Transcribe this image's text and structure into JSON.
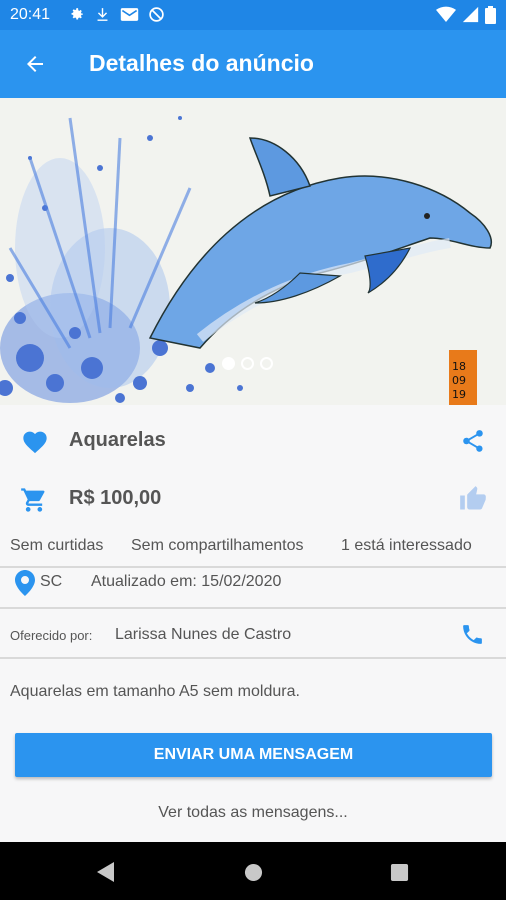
{
  "status_bar": {
    "time": "20:41",
    "left_icons": [
      "gear-icon",
      "download-icon",
      "gmail-icon",
      "do-not-disturb-icon"
    ],
    "right_icons": [
      "wifi-icon",
      "signal-icon",
      "battery-icon"
    ]
  },
  "app_bar": {
    "title": "Detalhes do anúncio",
    "back_icon": "arrow-left-icon"
  },
  "gallery": {
    "image": "watercolor-dolphin-painting",
    "dot_count": 3,
    "active_index": 0,
    "painting_label": "18 09 19"
  },
  "item": {
    "title": "Aquarelas",
    "price": "R$ 100,00",
    "stats": {
      "likes": "Sem curtidas",
      "shares": "Sem compartilhamentos",
      "interested": "1 está interessado"
    },
    "location": "SC",
    "updated": "Atualizado em: 15/02/2020",
    "offered_by_label": "Oferecido por:",
    "seller": "Larissa Nunes de Castro",
    "description": "Aquarelas em tamanho A5 sem moldura."
  },
  "actions": {
    "send_message": "ENVIAR UMA MENSAGEM",
    "see_all_messages": "Ver todas as mensagens..."
  },
  "colors": {
    "primary": "#2b94ef",
    "status_bar": "#1f86e6",
    "accent": "#2b94ef"
  }
}
